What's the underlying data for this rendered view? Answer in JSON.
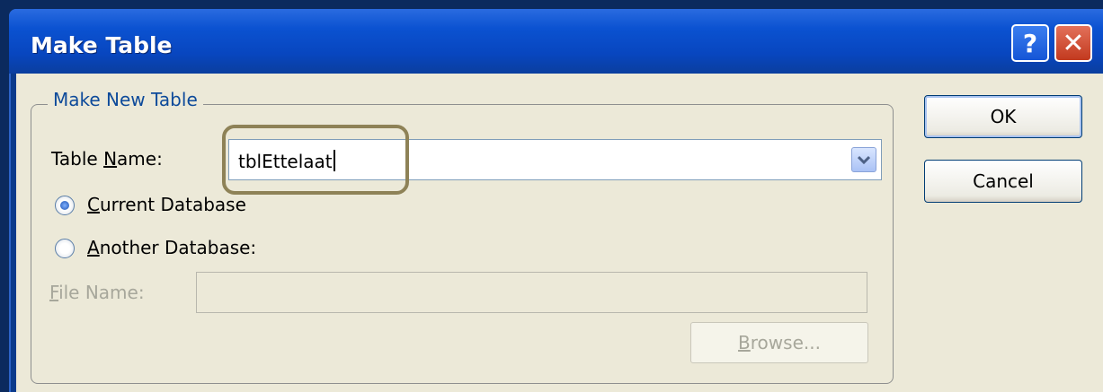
{
  "dialog": {
    "title": "Make Table",
    "help_label": "?",
    "close_label": "✕"
  },
  "group": {
    "legend": "Make New Table",
    "table_name_label_pre": "Table ",
    "table_name_label_key": "N",
    "table_name_label_post": "ame:",
    "table_name_value": "tblEttelaat",
    "current_db_key": "C",
    "current_db_rest": "urrent Database",
    "current_db_checked": true,
    "another_db_key": "A",
    "another_db_rest": "nother Database:",
    "another_db_checked": false,
    "file_name_key": "F",
    "file_name_rest": "ile Name:",
    "file_name_value": "",
    "browse_key": "B",
    "browse_rest": "rowse..."
  },
  "buttons": {
    "ok": "OK",
    "cancel": "Cancel"
  }
}
